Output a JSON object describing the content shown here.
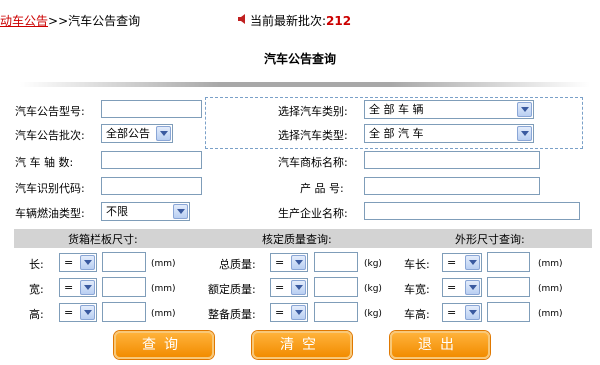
{
  "header": {
    "breadcrumb_link": "动车公告",
    "breadcrumb_rest": ">>汽车公告查询",
    "batch_label": "当前最新批次:",
    "batch_number": "212"
  },
  "title": "汽车公告查询",
  "form": {
    "model_label": "汽车公告型号:",
    "category_label": "选择汽车类别:",
    "category_value": "全 部 车 辆",
    "batch_label": "汽车公告批次:",
    "batch_value": "全部公告",
    "type_label": "选择汽车类型:",
    "type_value": "全 部 汽 车",
    "axle_label": "汽 车 轴 数:",
    "brand_label": "汽车商标名称:",
    "vin_label": "汽车识别代码:",
    "product_label": "产 品 号:",
    "fuel_label": "车辆燃油类型:",
    "fuel_value": "不限",
    "maker_label": "生产企业名称:"
  },
  "sections": {
    "cargo": "货箱栏板尺寸:",
    "mass": "核定质量查询:",
    "outline": "外形尺寸查询:"
  },
  "cargo": {
    "length": "长:",
    "width": "宽:",
    "height": "高:"
  },
  "mass": {
    "total": "总质量:",
    "rated": "额定质量:",
    "curb": "整备质量:"
  },
  "outline": {
    "length": "车长:",
    "width": "车宽:",
    "height": "车高:"
  },
  "operator": "=",
  "units": {
    "mm": "(mm)",
    "kg": "(kg)"
  },
  "buttons": {
    "query": "查询",
    "clear": "清空",
    "exit": "退出"
  }
}
